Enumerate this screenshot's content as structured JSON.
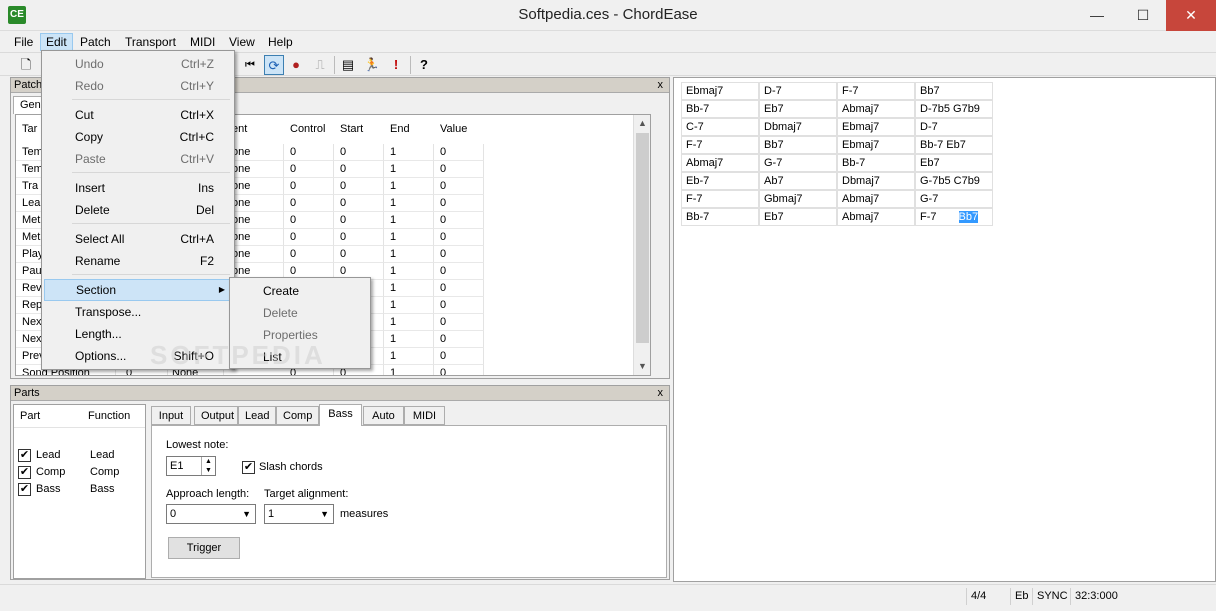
{
  "window": {
    "title": "Softpedia.ces - ChordEase",
    "minimize": "—",
    "maximize": "☐",
    "close": "✕"
  },
  "menubar": [
    "File",
    "Edit",
    "Patch",
    "Transport",
    "MIDI",
    "View",
    "Help"
  ],
  "toolbar_icons": [
    "new-icon",
    "open-icon",
    "save-icon",
    "rewind-icon",
    "loop-icon",
    "record-icon",
    "punch-icon",
    "book-icon",
    "run-icon",
    "alert-icon",
    "help-icon"
  ],
  "edit_menu": {
    "items": [
      {
        "label": "Undo",
        "shortcut": "Ctrl+Z",
        "enabled": false
      },
      {
        "label": "Redo",
        "shortcut": "Ctrl+Y",
        "enabled": false
      },
      {
        "label": "Cut",
        "shortcut": "Ctrl+X",
        "enabled": true
      },
      {
        "label": "Copy",
        "shortcut": "Ctrl+C",
        "enabled": true
      },
      {
        "label": "Paste",
        "shortcut": "Ctrl+V",
        "enabled": false
      },
      {
        "label": "Insert",
        "shortcut": "Ins",
        "enabled": true
      },
      {
        "label": "Delete",
        "shortcut": "Del",
        "enabled": true
      },
      {
        "label": "Select All",
        "shortcut": "Ctrl+A",
        "enabled": true
      },
      {
        "label": "Rename",
        "shortcut": "F2",
        "enabled": true
      },
      {
        "label": "Section",
        "shortcut": "",
        "enabled": true,
        "submenu": true
      },
      {
        "label": "Transpose...",
        "shortcut": "",
        "enabled": true
      },
      {
        "label": "Length...",
        "shortcut": "",
        "enabled": true
      },
      {
        "label": "Options...",
        "shortcut": "Shift+O",
        "enabled": true
      }
    ],
    "submenu_arrow": "▶"
  },
  "section_menu": [
    {
      "label": "Create",
      "enabled": true
    },
    {
      "label": "Delete",
      "enabled": false
    },
    {
      "label": "Properties",
      "enabled": false
    },
    {
      "label": "List",
      "enabled": true
    }
  ],
  "patch_panel": {
    "title": "Patch",
    "close": "x",
    "tab": "Gen",
    "columns": [
      "Tar",
      "ent",
      "Control",
      "Start",
      "End",
      "Value"
    ],
    "rows": [
      [
        "Tem",
        "one",
        "0",
        "0",
        "1",
        "0"
      ],
      [
        "Tem",
        "one",
        "0",
        "0",
        "1",
        "0"
      ],
      [
        "Tra",
        "one",
        "0",
        "0",
        "1",
        "0"
      ],
      [
        "Lea",
        "one",
        "0",
        "0",
        "1",
        "0"
      ],
      [
        "Met",
        "one",
        "0",
        "0",
        "1",
        "0"
      ],
      [
        "Met",
        "one",
        "0",
        "0",
        "1",
        "0"
      ],
      [
        "Play",
        "one",
        "0",
        "0",
        "1",
        "0"
      ],
      [
        "Pau",
        "one",
        "0",
        "0",
        "1",
        "0"
      ],
      [
        "Rev",
        "",
        "",
        "",
        "1",
        "0"
      ],
      [
        "Rep",
        "",
        "",
        "",
        "1",
        "0"
      ],
      [
        "Nex",
        "",
        "",
        "",
        "1",
        "0"
      ],
      [
        "Nex",
        "",
        "",
        "",
        "1",
        "0"
      ],
      [
        "Prev",
        "",
        "",
        "",
        "1",
        "0"
      ],
      [
        "Song Position",
        "0",
        "None",
        "0",
        "0",
        "1",
        "0"
      ]
    ]
  },
  "parts_panel": {
    "title": "Parts",
    "close": "x",
    "columns": [
      "Part",
      "Function"
    ],
    "parts": [
      {
        "part": "Lead",
        "function": "Lead",
        "checked": true
      },
      {
        "part": "Comp",
        "function": "Comp",
        "checked": true
      },
      {
        "part": "Bass",
        "function": "Bass",
        "checked": true
      }
    ],
    "tabs": [
      "Input",
      "Output",
      "Lead",
      "Comp",
      "Bass",
      "Auto",
      "MIDI"
    ],
    "active_tab": "Bass",
    "bass": {
      "lowest_note_label": "Lowest note:",
      "lowest_note": "E1",
      "slash_chords_label": "Slash chords",
      "slash_chords": true,
      "approach_length_label": "Approach length:",
      "approach_length": "0",
      "target_alignment_label": "Target alignment:",
      "target_alignment": "1",
      "measures_label": "measures",
      "trigger_label": "Trigger"
    }
  },
  "chords": [
    [
      "Ebmaj7",
      "D-7",
      "F-7",
      "Bb7"
    ],
    [
      "Bb-7",
      "Eb7",
      "Abmaj7",
      "D-7b5  G7b9"
    ],
    [
      "C-7",
      "Dbmaj7",
      "Ebmaj7",
      "D-7"
    ],
    [
      "F-7",
      "Bb7",
      "Ebmaj7",
      "Bb-7  Eb7"
    ],
    [
      "Abmaj7",
      "G-7",
      "Bb-7",
      "Eb7"
    ],
    [
      "Eb-7",
      "Ab7",
      "Dbmaj7",
      "G-7b5  C7b9"
    ],
    [
      "F-7",
      "Gbmaj7",
      "Abmaj7",
      "G-7"
    ],
    [
      "Bb-7",
      "Eb7",
      "Abmaj7",
      "F-7"
    ]
  ],
  "selected_chord": "Bb7",
  "status": {
    "meter": "4/4",
    "key": "Eb",
    "sync": "SYNC",
    "position": "32:3:000"
  },
  "watermark": "SOFTPEDIA"
}
